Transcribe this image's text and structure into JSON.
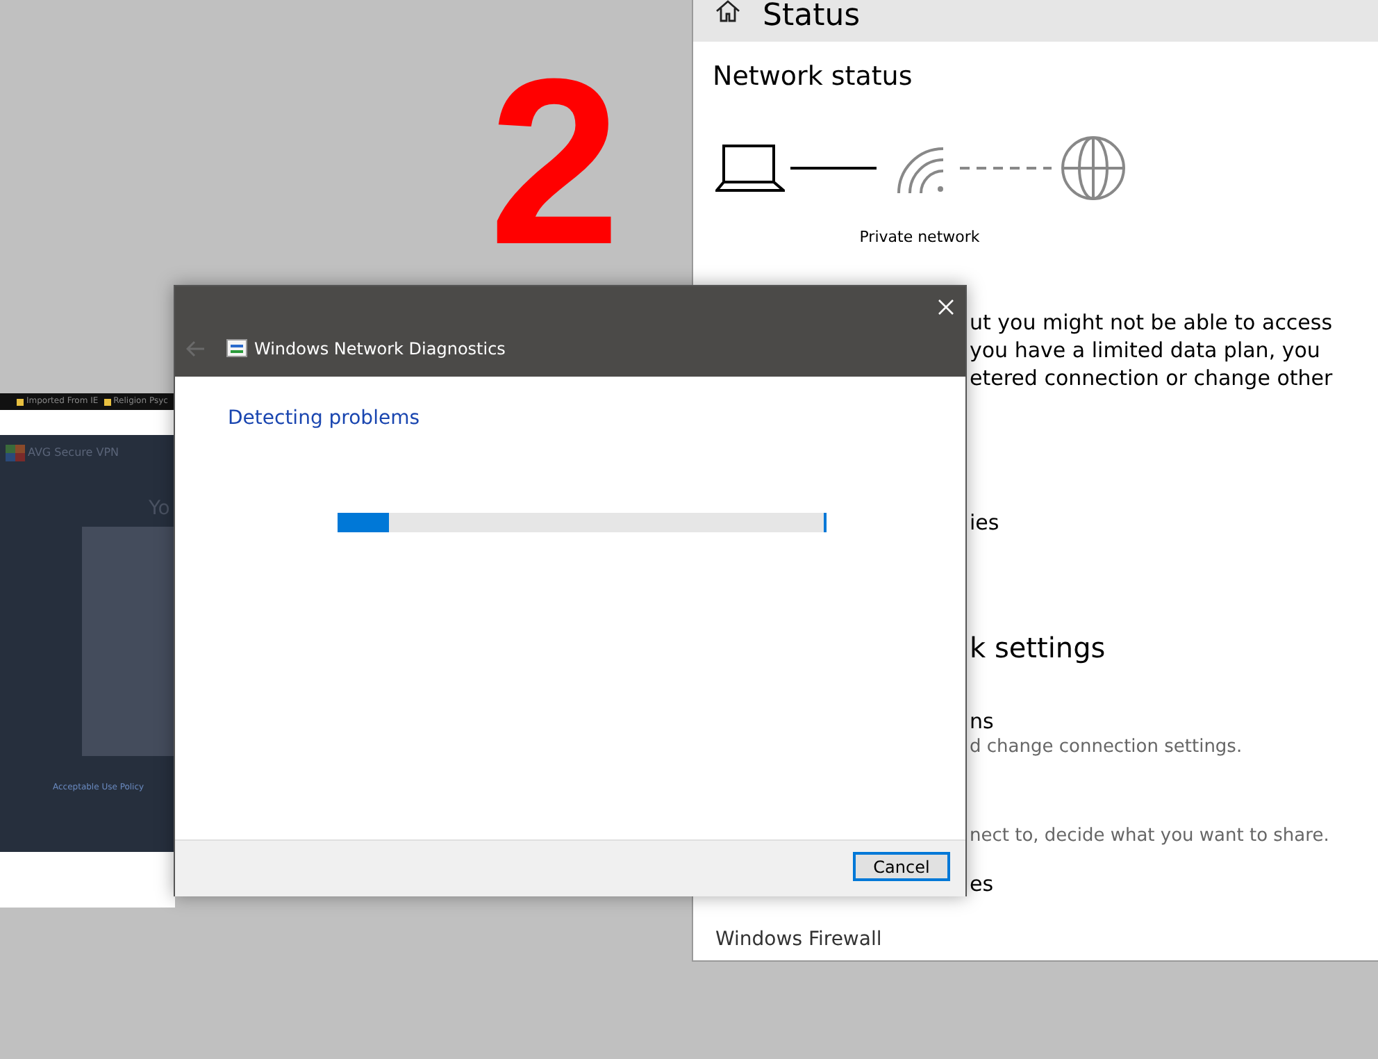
{
  "annotation": {
    "text": "2"
  },
  "settings_window": {
    "title": "Status",
    "heading": "Network status",
    "network_label": "Private network",
    "lines": [
      {
        "text": "ut you might not be able to access",
        "kind": "body"
      },
      {
        "text": "you have a limited data plan, you",
        "kind": "body"
      },
      {
        "text": "etered connection or change other",
        "kind": "body"
      },
      {
        "text": "ies",
        "kind": "link"
      },
      {
        "text": "k settings",
        "kind": "heading"
      },
      {
        "text": "ns",
        "kind": "title"
      },
      {
        "text": "d change connection settings.",
        "kind": "desc"
      },
      {
        "text": "nect to, decide what you want to share.",
        "kind": "desc"
      },
      {
        "text": "es",
        "kind": "title"
      }
    ],
    "footer_item": "Windows Firewall"
  },
  "browser_window": {
    "bookmarks": [
      "Imported From IE",
      "Religion Psyc"
    ],
    "app_name": "AVG Secure VPN",
    "heading": "Yo",
    "link": "Acceptable Use Policy"
  },
  "dialog": {
    "title": "Windows Network Diagnostics",
    "status": "Detecting problems",
    "progress": {
      "level": 0.105
    },
    "buttons": [
      {
        "label": "Cancel",
        "selected": true
      }
    ]
  }
}
